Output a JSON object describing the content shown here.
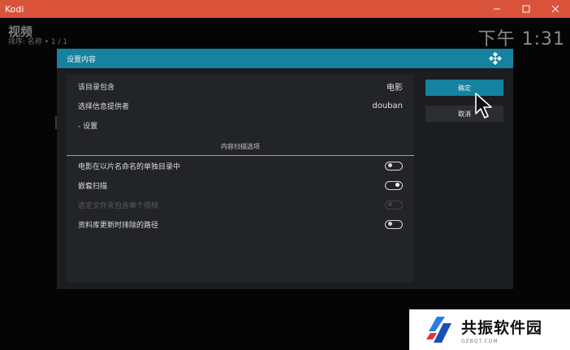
{
  "window": {
    "title": "Kodi",
    "minimize_icon": "minimize-icon",
    "maximize_icon": "maximize-icon",
    "close_icon": "close-icon"
  },
  "background": {
    "section_title": "视频",
    "sort_info": "排序: 名称  •  1 / 1",
    "clock": "下午 1:31"
  },
  "dialog": {
    "title": "设置内容",
    "logo_icon": "kodi-logo-icon",
    "rows": [
      {
        "label": "该目录包含",
        "value": "电影"
      },
      {
        "label": "选择信息提供者",
        "value": "douban"
      },
      {
        "label": "- 设置",
        "value": ""
      }
    ],
    "section_title": "内容扫描选项",
    "options": [
      {
        "label": "电影在以片名命名的单独目录中",
        "state": "off",
        "enabled": true
      },
      {
        "label": "嵌套扫描",
        "state": "on",
        "enabled": true
      },
      {
        "label": "选定文件夹包含单个视频",
        "state": "off",
        "enabled": false
      },
      {
        "label": "资料库更新时排除的路径",
        "state": "off",
        "enabled": true
      }
    ],
    "ok_label": "确定",
    "cancel_label": "取消"
  },
  "watermark": {
    "name": "共振软件园",
    "url": "GZBQT.COM"
  },
  "colors": {
    "titlebar": "#d9533a",
    "accent": "#15829f",
    "dialog_bg": "#1b1d20",
    "panel_bg": "#222427"
  }
}
